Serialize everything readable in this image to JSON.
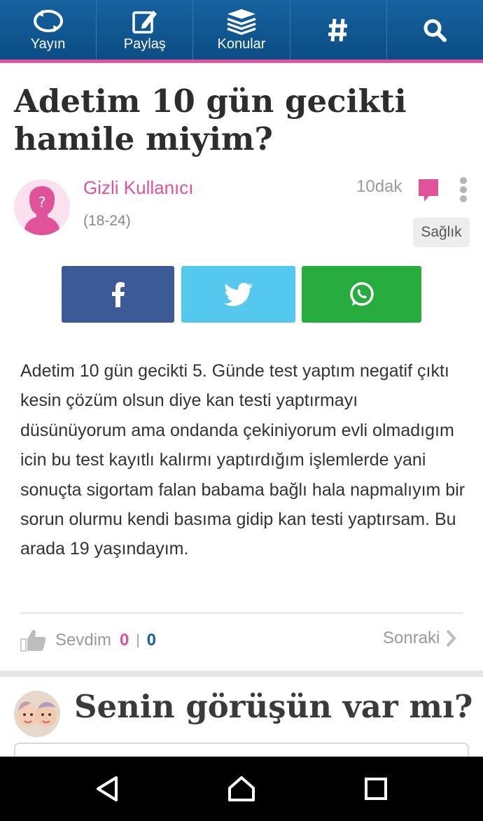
{
  "nav": {
    "items": [
      {
        "label": "Yayın",
        "icon": "refresh-loop-icon"
      },
      {
        "label": "Paylaş",
        "icon": "edit-pencil-icon"
      },
      {
        "label": "Konular",
        "icon": "stack-books-icon"
      },
      {
        "label": "",
        "icon": "hashtag-icon"
      },
      {
        "label": "",
        "icon": "search-icon"
      }
    ]
  },
  "post": {
    "title": "Adetim 10 gün gecikti hamile miyim?",
    "author": "Gizli Kullanıcı",
    "age_range": "(18-24)",
    "time": "10dak",
    "category": "Sağlık",
    "body": "Adetim 10 gün gecikti 5. Günde test yaptım negatif çıktı kesin çözüm olsun diye kan testi yaptırmayı düsünüyorum ama ondanda çekiniyorum evli olmadıgım icin bu test kayıtlı kalırmı yaptırdığım işlemlerde yani sonuçta sigortam falan babama bağlı hala napmalıyım bir sorun olurmu kendi basıma gidip kan testi yaptırsam. Bu arada 19 yaşındayım."
  },
  "share": {
    "facebook_color": "#3b5a97",
    "twitter_color": "#55c8ef",
    "whatsapp_color": "#26ad3e"
  },
  "reactions": {
    "like_label": "Sevdim",
    "like_count": "0",
    "separator": "|",
    "second_count": "0",
    "next_label": "Sonraki"
  },
  "comment_section": {
    "prompt": "Senin görüşün var mı?"
  },
  "colors": {
    "brand_blue": "#0c4d85",
    "accent_pink": "#e0539b"
  }
}
